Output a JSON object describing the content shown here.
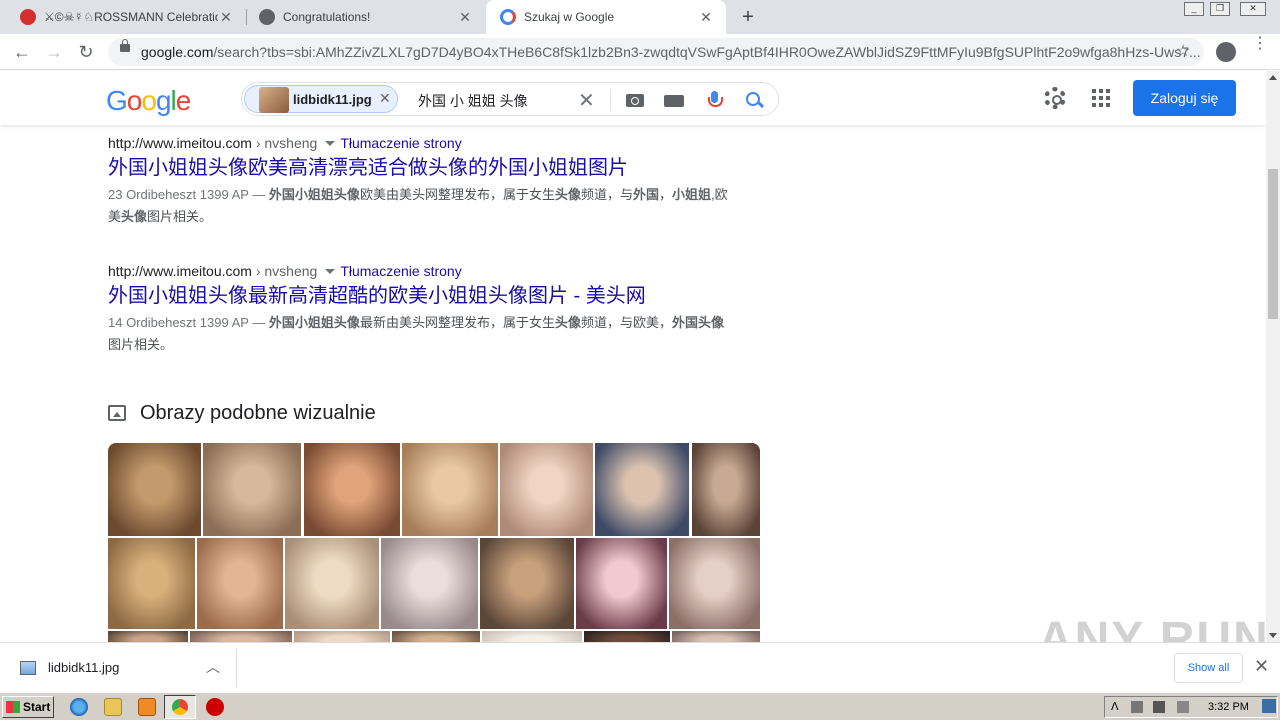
{
  "browser": {
    "tabs": [
      {
        "title": "ROSSMANN Celebration of t",
        "prefix": "⚔©☠☿♘",
        "favicon_color": "#d32f2f",
        "active": false
      },
      {
        "title": "Congratulations!",
        "favicon_color": "#5f6368",
        "active": false
      },
      {
        "title": "Szukaj w Google",
        "favicon_color": "#4285f4",
        "active": true
      }
    ],
    "new_tab_icon": "plus-icon",
    "address_host": "google.com",
    "address_path": "/search?tbs=sbi:AMhZZivZLXL7gD7D4yBO4xTHeB6C8fSk1lzb2Bn3-zwqdtqVSwFgAptBf4IHR0OweZAWblJidSZ9FttMFyIu9BfgSUPlhtF2o9wfga8hHzs-Uws7..."
  },
  "google": {
    "logo_letters": [
      {
        "ch": "G",
        "color": "#4285f4"
      },
      {
        "ch": "o",
        "color": "#ea4335"
      },
      {
        "ch": "o",
        "color": "#fbbc05"
      },
      {
        "ch": "g",
        "color": "#4285f4"
      },
      {
        "ch": "l",
        "color": "#34a853"
      },
      {
        "ch": "e",
        "color": "#ea4335"
      }
    ],
    "image_chip": "lidbidk11.jpg",
    "query": "外国 小 姐姐 头像",
    "signin_label": "Zaloguj się"
  },
  "results": [
    {
      "site": "http://www.imeitou.com",
      "breadcrumb": " › nvsheng",
      "translate": "Tłumaczenie strony",
      "title": "外国小姐姐头像欧美高清漂亮适合做头像的外国小姐姐图片",
      "date": "23 Ordibeheszt 1399 AP — ",
      "snippet_parts": [
        {
          "text": "外国小姐姐头像",
          "bold": true
        },
        {
          "text": "欧美由美头网整理发布，属于女生",
          "bold": false
        },
        {
          "text": "头像",
          "bold": true
        },
        {
          "text": "频道，与",
          "bold": false
        },
        {
          "text": "外国",
          "bold": true
        },
        {
          "text": "，",
          "bold": false
        },
        {
          "text": "小姐姐",
          "bold": true
        },
        {
          "text": ",欧美",
          "bold": false
        },
        {
          "text": "头像",
          "bold": true
        },
        {
          "text": "图片相关。",
          "bold": false
        }
      ]
    },
    {
      "site": "http://www.imeitou.com",
      "breadcrumb": " › nvsheng",
      "translate": "Tłumaczenie strony",
      "title": "外国小姐姐头像最新高清超酷的欧美小姐姐头像图片 - 美头网",
      "date": "14 Ordibeheszt 1399 AP — ",
      "snippet_parts": [
        {
          "text": "外国小姐姐头像",
          "bold": true
        },
        {
          "text": "最新由美头网整理发布，属于女生",
          "bold": false
        },
        {
          "text": "头像",
          "bold": true
        },
        {
          "text": "频道，与欧美，",
          "bold": false
        },
        {
          "text": "外国头像",
          "bold": true
        },
        {
          "text": "图片相关。",
          "bold": false
        }
      ]
    }
  ],
  "similar_heading": "Obrazy podobne wizualnie",
  "download": {
    "filename": "lidbidk11.jpg",
    "show_all": "Show all"
  },
  "watermark": "ANY RUN",
  "taskbar": {
    "start_label": "Start",
    "clock": "3:32 PM"
  }
}
